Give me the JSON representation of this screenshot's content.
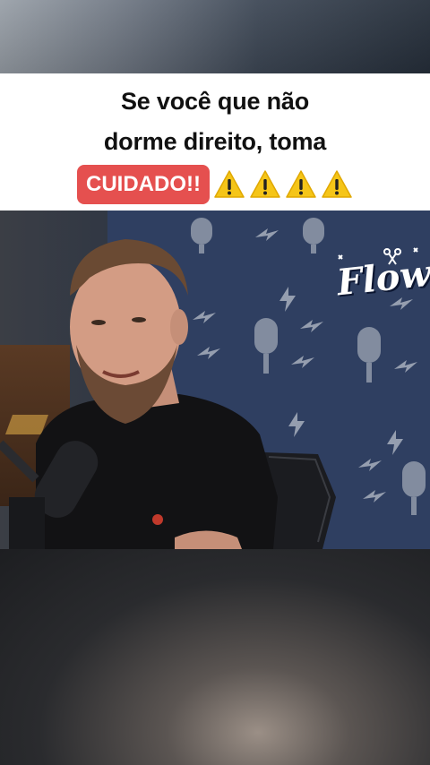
{
  "caption": {
    "line1": "Se você que não",
    "line2": "dorme direito, toma",
    "highlight": "CUIDADO!!",
    "warning_icons": [
      "warning-icon",
      "warning-icon",
      "warning-icon",
      "warning-icon"
    ]
  },
  "logo": {
    "text": "Flow"
  },
  "colors": {
    "highlight_bg": "#e5504f",
    "warning_yellow": "#f5c518",
    "wall_blue": "#2f3f61"
  }
}
